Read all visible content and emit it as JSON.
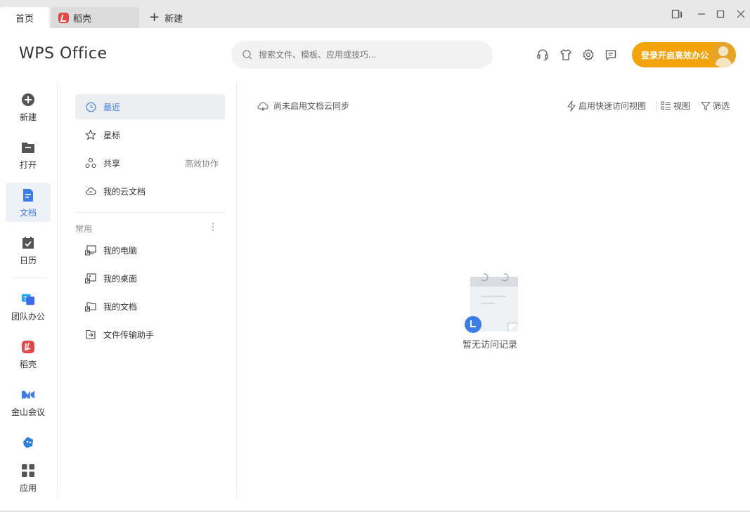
{
  "tabs": {
    "home": "首页",
    "docer": "稻壳",
    "new": "新建"
  },
  "header": {
    "brand": "WPS Office",
    "search_placeholder": "搜索文件、模板、应用或技巧...",
    "login_label": "登录开启高效办公"
  },
  "rail": {
    "new": "新建",
    "open": "打开",
    "docs": "文档",
    "calendar": "日历",
    "team": "团队办公",
    "docer": "稻壳",
    "meeting": "金山会议",
    "apps": "应用"
  },
  "nav": {
    "recent": "最近",
    "starred": "星标",
    "shared": "共享",
    "shared_extra": "高效协作",
    "cloud_docs": "我的云文档",
    "section_common": "常用",
    "my_computer": "我的电脑",
    "my_desktop": "我的桌面",
    "my_documents": "我的文档",
    "file_transfer": "文件传输助手"
  },
  "main": {
    "cloud_sync_note": "尚未启用文档云同步",
    "quick_access": "启用快速访问视图",
    "view": "视图",
    "filter": "筛选",
    "empty_text": "暂无访问记录"
  },
  "colors": {
    "accent": "#3e7de8",
    "login_button": "#f3a30b",
    "titlebar": "#e8e8e8"
  }
}
